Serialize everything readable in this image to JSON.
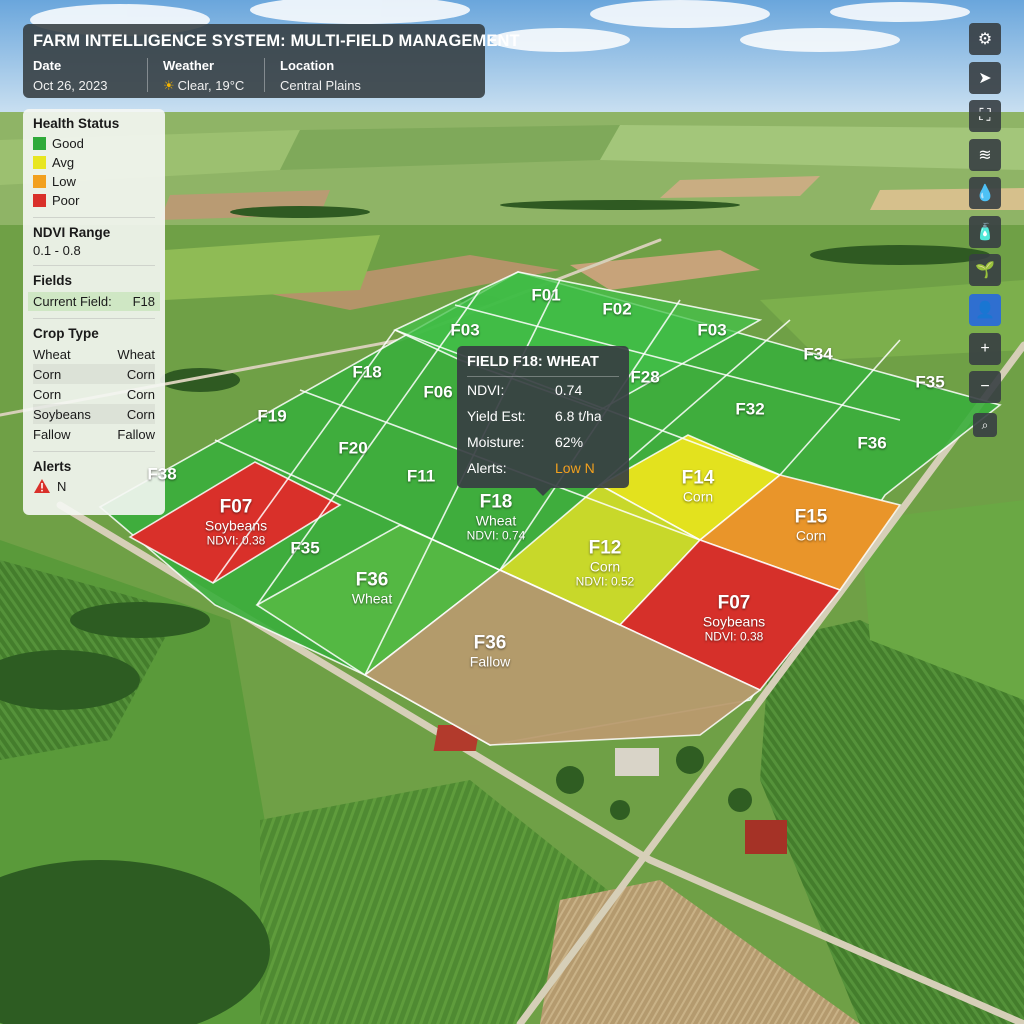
{
  "header": {
    "title": "FARM INTELLIGENCE SYSTEM: MULTI-FIELD MANAGEMENT",
    "date_label": "Date",
    "date_value": "Oct 26, 2023",
    "weather_label": "Weather",
    "weather_value": "Clear, 19°C",
    "weather_icon": "sun-icon",
    "location_label": "Location",
    "location_value": "Central Plains"
  },
  "legend": {
    "health_title": "Health Status",
    "health": [
      {
        "label": "Good",
        "color": "#2faa3a"
      },
      {
        "label": "Avg",
        "color": "#e8e620"
      },
      {
        "label": "Low",
        "color": "#f2a01e"
      },
      {
        "label": "Poor",
        "color": "#d9302a"
      }
    ],
    "ndvi_title": "NDVI Range",
    "ndvi_value": "0.1 - 0.8",
    "fields_title": "Fields",
    "current_field_label": "Current Field:",
    "current_field_value": "F18",
    "crop_title": "Crop Type",
    "crops": [
      {
        "left": "Wheat",
        "right": "Wheat"
      },
      {
        "left": "Corn",
        "right": "Corn"
      },
      {
        "left": "Corn",
        "right": "Corn"
      },
      {
        "left": "Soybeans",
        "right": "Corn"
      },
      {
        "left": "Fallow",
        "right": "Fallow"
      }
    ],
    "alerts_title": "Alerts",
    "alert_value": "N"
  },
  "toolbar": [
    {
      "icon": "gear-icon",
      "glyph": "⚙"
    },
    {
      "icon": "navigate-icon",
      "glyph": "➤"
    },
    {
      "icon": "fullscreen-icon",
      "glyph": "⛶"
    },
    {
      "icon": "layers-icon",
      "glyph": "≋"
    },
    {
      "icon": "water-drop-icon",
      "glyph": "💧"
    },
    {
      "icon": "fertilizer-bottle-icon",
      "glyph": "🧴"
    },
    {
      "icon": "crop-growth-icon",
      "glyph": "🌱"
    },
    {
      "icon": "farmer-icon",
      "glyph": "👤"
    },
    {
      "icon": "zoom-in-icon",
      "glyph": "+"
    },
    {
      "icon": "zoom-out-icon",
      "glyph": "−"
    },
    {
      "icon": "search-icon",
      "glyph": "⌕"
    }
  ],
  "fields": [
    {
      "id": "F01"
    },
    {
      "id": "F02"
    },
    {
      "id": "F03"
    },
    {
      "id": "F03"
    },
    {
      "id": "F34"
    },
    {
      "id": "F35"
    },
    {
      "id": "F28"
    },
    {
      "id": "F32"
    },
    {
      "id": "F36"
    },
    {
      "id": "F18"
    },
    {
      "id": "F06"
    },
    {
      "id": "F19"
    },
    {
      "id": "F20"
    },
    {
      "id": "F11"
    },
    {
      "id": "F38"
    },
    {
      "id": "F07",
      "crop": "Soybeans",
      "ndvi": "NDVI: 0.38"
    },
    {
      "id": "F35"
    },
    {
      "id": "F36",
      "crop": "Wheat"
    },
    {
      "id": "F18",
      "crop": "Wheat",
      "ndvi": "NDVI: 0.74"
    },
    {
      "id": "F14",
      "crop": "Corn"
    },
    {
      "id": "F15",
      "crop": "Corn"
    },
    {
      "id": "F12",
      "crop": "Corn",
      "ndvi": "NDVI: 0.52"
    },
    {
      "id": "F07",
      "crop": "Soybeans",
      "ndvi": "NDVI: 0.38"
    },
    {
      "id": "F36",
      "crop": "Fallow"
    }
  ],
  "tooltip": {
    "title": "FIELD F18: WHEAT",
    "ndvi_label": "NDVI:",
    "ndvi_value": "0.74",
    "yield_label": "Yield Est:",
    "yield_value": "6.8 t/ha",
    "moisture_label": "Moisture:",
    "moisture_value": "62%",
    "alerts_label": "Alerts:",
    "alerts_value": "Low N",
    "alert_color": "#f2a01e"
  }
}
